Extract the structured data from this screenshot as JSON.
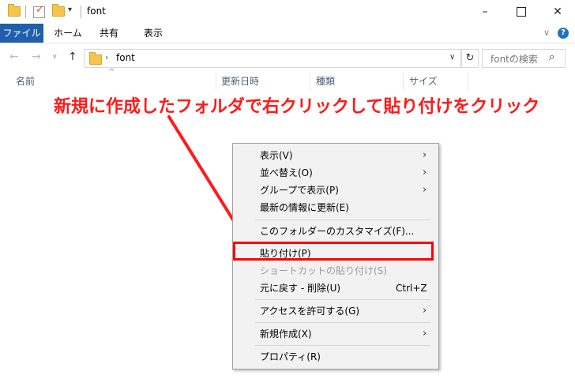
{
  "window": {
    "title": "font",
    "minimize": "–",
    "close": "✕"
  },
  "ribbon": {
    "tabs": [
      "ファイル",
      "ホーム",
      "共有",
      "表示"
    ]
  },
  "address": {
    "path": "font",
    "search_placeholder": "fontの検索"
  },
  "columns": [
    "名前",
    "更新日時",
    "種類",
    "サイズ"
  ],
  "annotation": "新規に作成したフォルダで右クリックして貼り付けをクリック",
  "context_menu": {
    "items": [
      {
        "label": "表示(V)",
        "submenu": true
      },
      {
        "label": "並べ替え(O)",
        "submenu": true
      },
      {
        "label": "グループで表示(P)",
        "submenu": true
      },
      {
        "label": "最新の情報に更新(E)"
      },
      {
        "label": "このフォルダーのカスタマイズ(F)..."
      },
      {
        "label": "貼り付け(P)",
        "highlighted": true
      },
      {
        "label": "ショートカットの貼り付け(S)",
        "disabled": true
      },
      {
        "label": "元に戻す - 削除(U)",
        "shortcut": "Ctrl+Z"
      },
      {
        "label": "アクセスを許可する(G)",
        "submenu": true
      },
      {
        "label": "新規作成(X)",
        "submenu": true
      },
      {
        "label": "プロパティ(R)"
      }
    ]
  },
  "colors": {
    "annotation": "#ff1a1a",
    "file_tab": "#1f5fab",
    "highlight_border": "#ff0000"
  }
}
